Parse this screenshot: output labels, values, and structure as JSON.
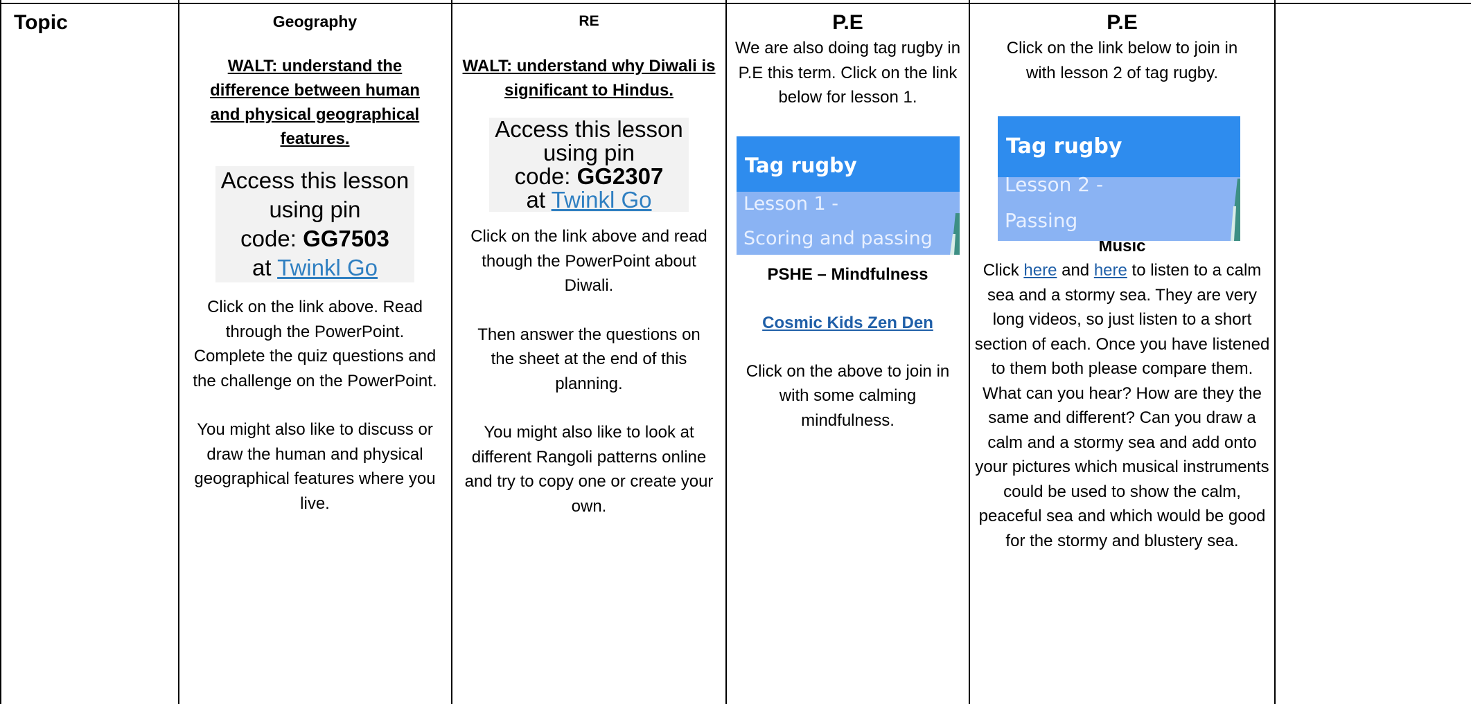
{
  "topic_label": "Topic",
  "geography": {
    "subject": "Geography",
    "walt": "WALT: understand the difference between human and physical geographical features.",
    "access_line1": "Access this lesson",
    "access_line2": "using pin",
    "access_code_prefix": "code:",
    "pin_code": "GG7503",
    "at": "at",
    "link_text": "Twinkl Go",
    "instructions": "Click on the link above. Read through the PowerPoint. Complete the quiz questions and the challenge on the PowerPoint.",
    "extra": "You might also like to discuss or draw the human and physical geographical features where you live."
  },
  "re": {
    "subject": "RE",
    "walt": "WALT: understand why Diwali is significant to Hindus.",
    "access_line1": "Access this lesson",
    "access_line2": "using pin",
    "access_code_prefix": "code:",
    "pin_code": "GG2307",
    "at": "at",
    "link_text": "Twinkl Go",
    "instructions": "Click on the link above and read though the PowerPoint about Diwali.",
    "questions": "Then answer the questions on the sheet at the end of this planning.",
    "extra": "You might also like to look at different Rangoli patterns online and try to copy one or create your own."
  },
  "pe1": {
    "subject": "P.E",
    "intro": "We are also doing tag rugby in P.E this term. Click on the link below for lesson 1.",
    "banner_title": "Tag rugby",
    "banner_line1": "Lesson 1 -",
    "banner_line2": "Scoring and passing",
    "pshe_heading": "PSHE – Mindfulness",
    "pshe_link": "Cosmic Kids Zen Den",
    "pshe_text": "Click on the above to join in with some calming mindfulness."
  },
  "pe2": {
    "subject": "P.E",
    "intro": "Click on the link below to join in with lesson 2 of tag rugby.",
    "banner_title": "Tag rugby",
    "banner_line1": "Lesson 2 -",
    "banner_line2": "Passing",
    "music_heading": "Music",
    "music_click": "Click",
    "music_link1": "here",
    "music_and": "and",
    "music_link2": "here",
    "music_text": "to listen to a calm sea and a stormy sea. They are very long videos, so just listen to a short section of each. Once you have listened to them both please compare them. What can you hear? How are they the same and different? Can you draw a calm and a stormy sea and add onto your pictures which musical instruments could be used to show the calm, peaceful sea and which would be good for the stormy and blustery sea."
  },
  "colors": {
    "link": "#2f7fc1",
    "dark_link": "#1f5fa8",
    "banner_top": "#2e8cee",
    "banner_bottom": "#8ab3f3"
  }
}
